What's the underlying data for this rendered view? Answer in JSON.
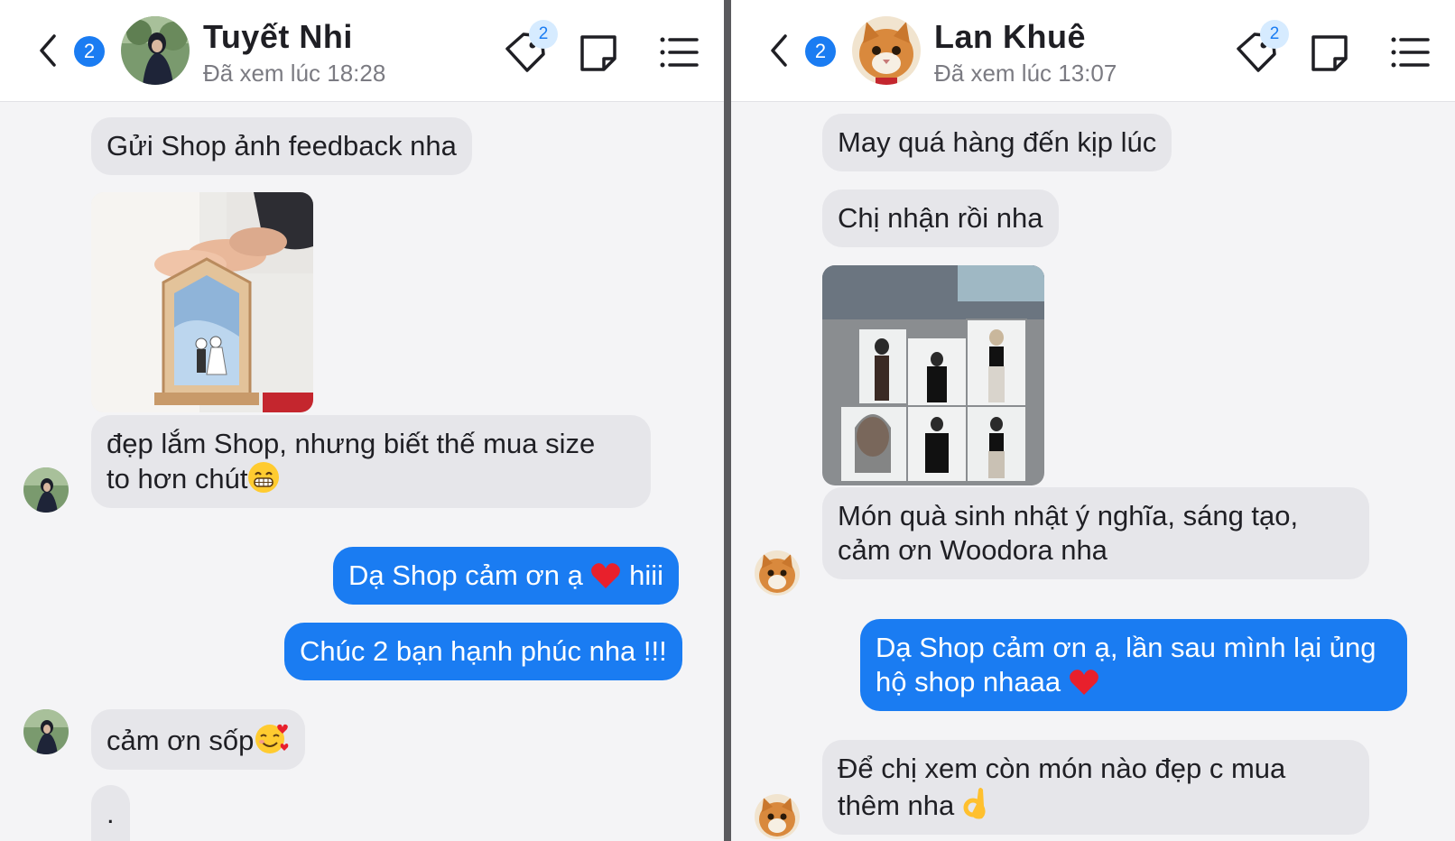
{
  "left": {
    "header": {
      "unread_count": "2",
      "name": "Tuyết Nhi",
      "seen_status": "Đã xem lúc 18:28",
      "tag_badge": "2"
    },
    "messages": {
      "m1": "Gửi Shop ảnh feedback nha",
      "m2_line1": "đẹp lắm Shop, nhưng biết thế mua size",
      "m2_line2": "to hơn chút",
      "m3": "Dạ Shop cảm ơn ạ",
      "m3_tail": " hiii",
      "m4": "Chúc 2 bạn hạnh phúc nha !!!",
      "m5": "cảm ơn sốp",
      "m6": "."
    }
  },
  "right": {
    "header": {
      "unread_count": "2",
      "name": "Lan Khuê",
      "seen_status": "Đã xem lúc 13:07",
      "tag_badge": "2"
    },
    "messages": {
      "m1": "May quá hàng đến kịp lúc",
      "m2": "Chị nhận rồi nha",
      "m3_line1": "Món quà sinh nhật ý nghĩa, sáng tạo,",
      "m3_line2": "cảm ơn Woodora nha",
      "m4_line1": "Dạ Shop cảm ơn ạ, lần sau mình lại ủng",
      "m4_line2": "hộ shop nhaaa",
      "m5_line1": "Để chị xem còn món nào đẹp c mua",
      "m5_line2": "thêm nha"
    }
  },
  "colors": {
    "accent": "#1a7cf2",
    "incoming_bubble": "#e6e6ea",
    "background": "#f4f4f6"
  },
  "icons": [
    "back-chevron-icon",
    "tag-icon",
    "note-icon",
    "list-menu-icon",
    "heart-emoji",
    "grin-emoji",
    "smiling-hearts-emoji",
    "ok-hand-emoji"
  ]
}
